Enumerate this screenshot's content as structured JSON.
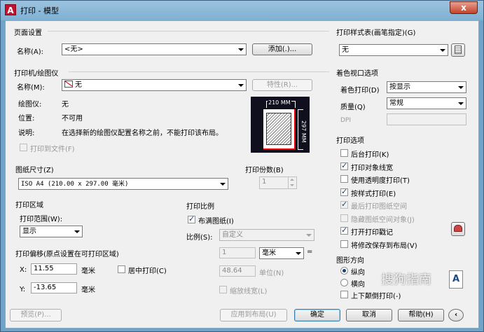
{
  "window": {
    "title": "打印 - 模型",
    "close": "x"
  },
  "page_setup": {
    "title": "页面设置",
    "name_label": "名称(A):",
    "name_value": "<无>",
    "add_button": "添加(.)..."
  },
  "printer": {
    "title": "打印机/绘图仪",
    "name_label": "名称(M):",
    "name_value": "无",
    "properties_button": "特性(R)...",
    "plotter_label": "绘图仪:",
    "plotter_value": "无",
    "location_label": "位置:",
    "location_value": "不可用",
    "desc_label": "说明:",
    "desc_value": "在选择新的绘图仪配置名称之前，不能打印该布局。",
    "print_to_file": "打印到文件(F)",
    "preview_width": "210 MM",
    "preview_height": "297 MM"
  },
  "paper_size": {
    "title": "图纸尺寸(Z)",
    "value": "ISO A4 (210.00 x 297.00 毫米)"
  },
  "copies": {
    "title": "打印份数(B)",
    "value": "1"
  },
  "area": {
    "title": "打印区域",
    "range_label": "打印范围(W):",
    "range_value": "显示"
  },
  "scale": {
    "title": "打印比例",
    "fit_paper": "布满图纸(I)",
    "scale_label": "比例(S):",
    "scale_value": "自定义",
    "num": "1",
    "unit": "毫米",
    "eq": "=",
    "den": "48.64",
    "unit_label": "单位(N)",
    "lineweights": "缩放线宽(L)"
  },
  "offset": {
    "title": "打印偏移(原点设置在可打印区域)",
    "x_label": "X:",
    "x_value": "11.55",
    "x_unit": "毫米",
    "center": "居中打印(C)",
    "y_label": "Y:",
    "y_value": "-13.65",
    "y_unit": "毫米"
  },
  "style_table": {
    "title": "打印样式表(画笔指定)(G)",
    "value": "无"
  },
  "shaded": {
    "title": "着色视口选项",
    "shade_label": "着色打印(D)",
    "shade_value": "按显示",
    "quality_label": "质量(Q)",
    "quality_value": "常规",
    "dpi_label": "DPI"
  },
  "options": {
    "title": "打印选项",
    "items": [
      {
        "label": "后台打印(K)",
        "checked": false,
        "disabled": false
      },
      {
        "label": "打印对象线宽",
        "checked": true,
        "disabled": false
      },
      {
        "label": "使用透明度打印(T)",
        "checked": false,
        "disabled": false
      },
      {
        "label": "按样式打印(E)",
        "checked": true,
        "disabled": false
      },
      {
        "label": "最后打印图纸空间",
        "checked": true,
        "disabled": true
      },
      {
        "label": "隐藏图纸空间对象(J)",
        "checked": false,
        "disabled": true
      },
      {
        "label": "打开打印戳记",
        "checked": true,
        "disabled": false
      },
      {
        "label": "将修改保存到布局(V)",
        "checked": false,
        "disabled": false
      }
    ]
  },
  "orientation": {
    "title": "图形方向",
    "portrait": "纵向",
    "landscape": "横向",
    "upside_down": "上下颠倒打印(-)",
    "icon_letter": "A"
  },
  "footer": {
    "preview": "预览(P)...",
    "apply_layout": "应用到布局(U)",
    "ok": "确定",
    "cancel": "取消",
    "help": "帮助(H)"
  },
  "watermark": "搜狗指南",
  "colors": {
    "titlebar": "#7fb0d2",
    "accent": "#3c7fb1",
    "close": "#c4432a"
  }
}
